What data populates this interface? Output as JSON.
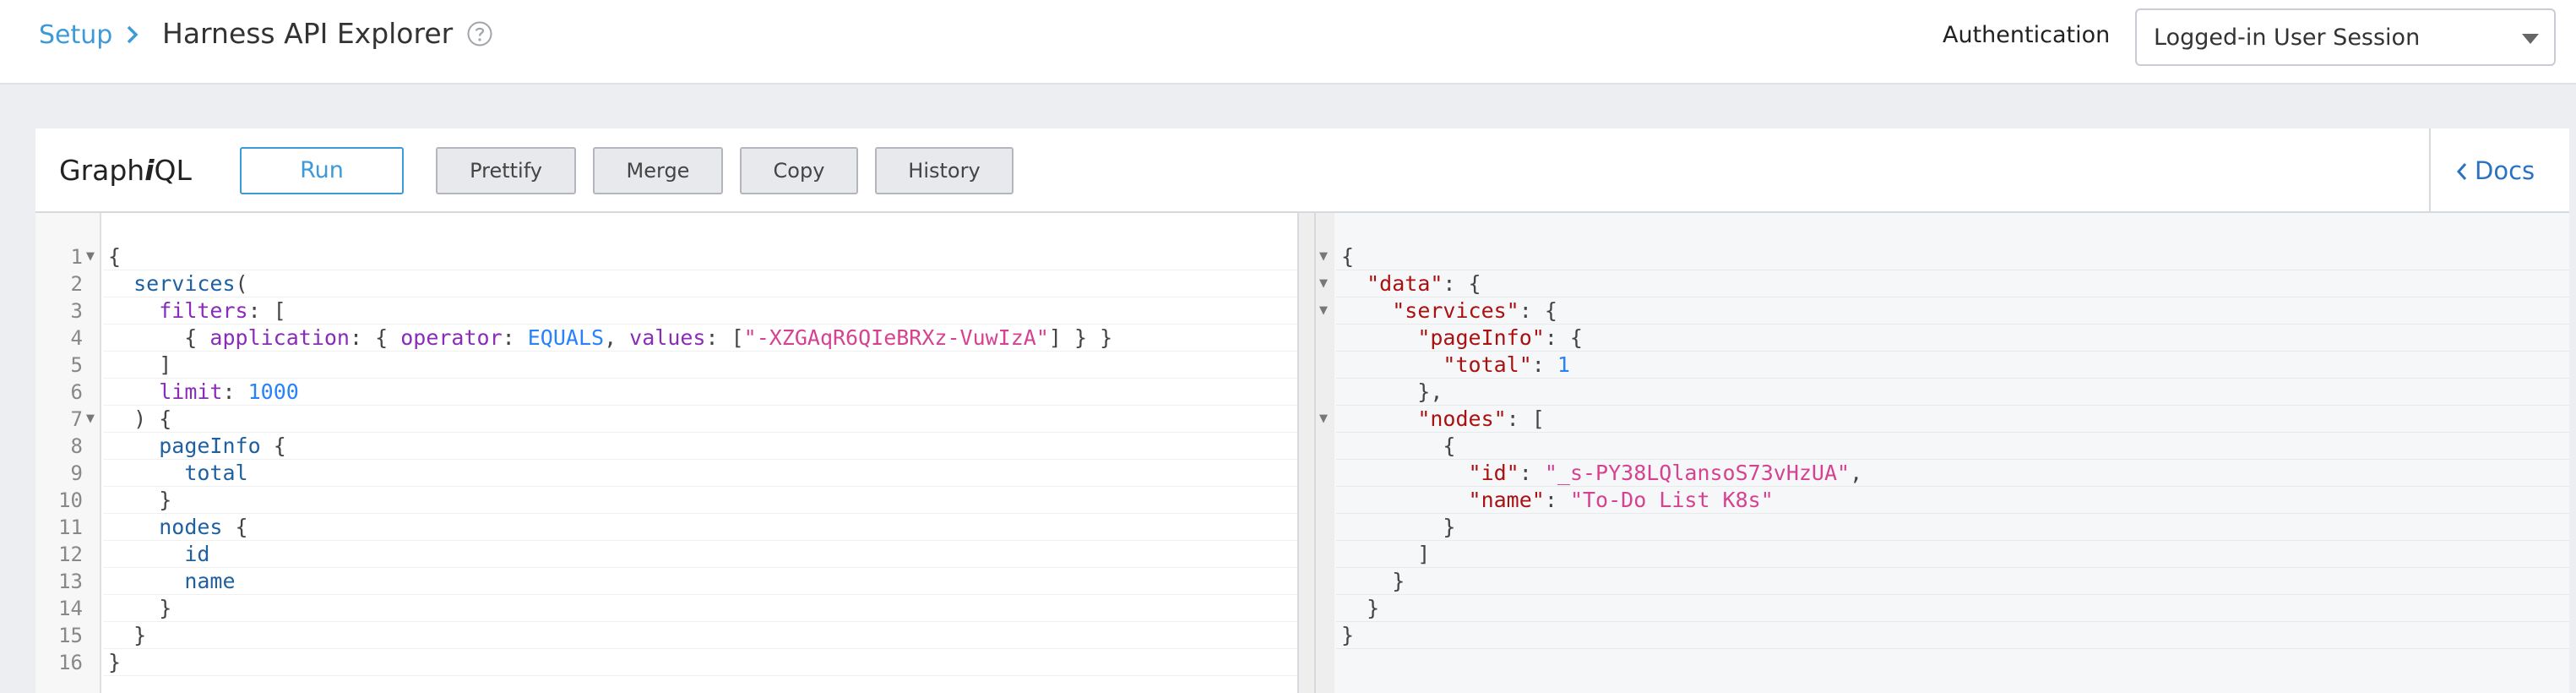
{
  "header": {
    "breadcrumb_setup": "Setup",
    "page_title": "Harness API Explorer",
    "auth_label": "Authentication",
    "auth_selected": "Logged-in User Session"
  },
  "toolbar": {
    "title_pre": "Graph",
    "title_i": "i",
    "title_post": "QL",
    "run_label": "Run",
    "prettify_label": "Prettify",
    "merge_label": "Merge",
    "copy_label": "Copy",
    "history_label": "History",
    "docs_label": "Docs"
  },
  "colors": {
    "accent": "#3d9ad9",
    "docs_link": "#2a72c2",
    "string": "#d64292",
    "keyword": "#1f61a0",
    "argument": "#8b2bb9",
    "number": "#2882f9",
    "json_key": "#aa1111"
  },
  "icons": {
    "breadcrumb_separator": "chevron-right-icon",
    "help": "help-circle-icon",
    "select_caret": "caret-down-icon",
    "docs": "chevron-left-icon",
    "fold": "fold-triangle-icon"
  },
  "query_editor": {
    "lines": [
      {
        "n": "1",
        "fold": true,
        "tokens": [
          [
            "p",
            "{"
          ]
        ]
      },
      {
        "n": "2",
        "fold": false,
        "tokens": [
          [
            "p",
            "  "
          ],
          [
            "kw",
            "services"
          ],
          [
            "p",
            "("
          ]
        ]
      },
      {
        "n": "3",
        "fold": false,
        "tokens": [
          [
            "p",
            "    "
          ],
          [
            "arg",
            "filters"
          ],
          [
            "p",
            ": ["
          ]
        ]
      },
      {
        "n": "4",
        "fold": false,
        "tokens": [
          [
            "p",
            "      { "
          ],
          [
            "arg",
            "application"
          ],
          [
            "p",
            ": { "
          ],
          [
            "arg",
            "operator"
          ],
          [
            "p",
            ": "
          ],
          [
            "enum",
            "EQUALS"
          ],
          [
            "p",
            ", "
          ],
          [
            "arg",
            "values"
          ],
          [
            "p",
            ": ["
          ],
          [
            "str",
            "\"-XZGAqR6QIeBRXz-VuwIzA\""
          ],
          [
            "p",
            "] } }"
          ]
        ]
      },
      {
        "n": "5",
        "fold": false,
        "tokens": [
          [
            "p",
            "    ]"
          ]
        ]
      },
      {
        "n": "6",
        "fold": false,
        "tokens": [
          [
            "p",
            "    "
          ],
          [
            "arg",
            "limit"
          ],
          [
            "p",
            ": "
          ],
          [
            "num",
            "1000"
          ]
        ]
      },
      {
        "n": "7",
        "fold": true,
        "tokens": [
          [
            "p",
            "  ) {"
          ]
        ]
      },
      {
        "n": "8",
        "fold": false,
        "tokens": [
          [
            "p",
            "    "
          ],
          [
            "kw",
            "pageInfo"
          ],
          [
            "p",
            " {"
          ]
        ]
      },
      {
        "n": "9",
        "fold": false,
        "tokens": [
          [
            "p",
            "      "
          ],
          [
            "kw",
            "total"
          ]
        ]
      },
      {
        "n": "10",
        "fold": false,
        "tokens": [
          [
            "p",
            "    }"
          ]
        ]
      },
      {
        "n": "11",
        "fold": false,
        "tokens": [
          [
            "p",
            "    "
          ],
          [
            "kw",
            "nodes"
          ],
          [
            "p",
            " {"
          ]
        ]
      },
      {
        "n": "12",
        "fold": false,
        "tokens": [
          [
            "p",
            "      "
          ],
          [
            "kw",
            "id"
          ]
        ]
      },
      {
        "n": "13",
        "fold": false,
        "tokens": [
          [
            "p",
            "      "
          ],
          [
            "kw",
            "name"
          ]
        ]
      },
      {
        "n": "14",
        "fold": false,
        "tokens": [
          [
            "p",
            "    }"
          ]
        ]
      },
      {
        "n": "15",
        "fold": false,
        "tokens": [
          [
            "p",
            "  }"
          ]
        ]
      },
      {
        "n": "16",
        "fold": false,
        "tokens": [
          [
            "p",
            "}"
          ]
        ]
      }
    ]
  },
  "result_viewer": {
    "lines": [
      {
        "fold": true,
        "tokens": [
          [
            "p",
            "{"
          ]
        ]
      },
      {
        "fold": true,
        "tokens": [
          [
            "p",
            "  "
          ],
          [
            "key",
            "\"data\""
          ],
          [
            "p",
            ": {"
          ]
        ]
      },
      {
        "fold": true,
        "tokens": [
          [
            "p",
            "    "
          ],
          [
            "key",
            "\"services\""
          ],
          [
            "p",
            ": {"
          ]
        ]
      },
      {
        "fold": false,
        "tokens": [
          [
            "p",
            "      "
          ],
          [
            "key",
            "\"pageInfo\""
          ],
          [
            "p",
            ": {"
          ]
        ]
      },
      {
        "fold": false,
        "tokens": [
          [
            "p",
            "        "
          ],
          [
            "key",
            "\"total\""
          ],
          [
            "p",
            ": "
          ],
          [
            "num",
            "1"
          ]
        ]
      },
      {
        "fold": false,
        "tokens": [
          [
            "p",
            "      },"
          ]
        ]
      },
      {
        "fold": true,
        "tokens": [
          [
            "p",
            "      "
          ],
          [
            "key",
            "\"nodes\""
          ],
          [
            "p",
            ": ["
          ]
        ]
      },
      {
        "fold": false,
        "tokens": [
          [
            "p",
            "        {"
          ]
        ]
      },
      {
        "fold": false,
        "tokens": [
          [
            "p",
            "          "
          ],
          [
            "key",
            "\"id\""
          ],
          [
            "p",
            ": "
          ],
          [
            "str",
            "\"_s-PY38LQlansoS73vHzUA\""
          ],
          [
            "p",
            ","
          ]
        ]
      },
      {
        "fold": false,
        "tokens": [
          [
            "p",
            "          "
          ],
          [
            "key",
            "\"name\""
          ],
          [
            "p",
            ": "
          ],
          [
            "str",
            "\"To-Do List K8s\""
          ]
        ]
      },
      {
        "fold": false,
        "tokens": [
          [
            "p",
            "        }"
          ]
        ]
      },
      {
        "fold": false,
        "tokens": [
          [
            "p",
            "      ]"
          ]
        ]
      },
      {
        "fold": false,
        "tokens": [
          [
            "p",
            "    }"
          ]
        ]
      },
      {
        "fold": false,
        "tokens": [
          [
            "p",
            "  }"
          ]
        ]
      },
      {
        "fold": false,
        "tokens": [
          [
            "p",
            "}"
          ]
        ]
      }
    ]
  }
}
